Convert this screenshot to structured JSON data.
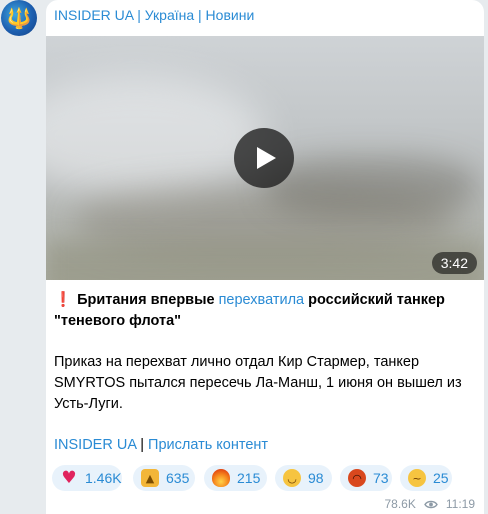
{
  "message": {
    "channel_name": "INSIDER UA | Україна | Новини",
    "video": {
      "duration": "3:42"
    },
    "text": {
      "exclamation": "❗",
      "headline_part1": "Британия впервые",
      "headline_link": "перехватила",
      "headline_part2": "российский танкер \"теневого флота\"",
      "body": "Приказ на перехват лично отдал Кир Стармер, танкер SMYRTOS пытался пересечь Ла-Манш, 1 июня он вышел из Усть-Луги."
    },
    "footer_links": {
      "channel": "INSIDER UA",
      "separator": "|",
      "submit": "Прислать контент"
    },
    "reactions": [
      {
        "emoji": "red-heart",
        "count": "1.46K"
      },
      {
        "emoji": "thumbs-up",
        "count": "635"
      },
      {
        "emoji": "fire",
        "count": "215"
      },
      {
        "emoji": "grinning-face",
        "count": "98"
      },
      {
        "emoji": "rage-face",
        "count": "73"
      },
      {
        "emoji": "thinking-face",
        "count": "25"
      }
    ],
    "views": "78.6K",
    "time": "11:19"
  },
  "colors": {
    "background": "#e7ebee",
    "bubble": "#ffffff",
    "link": "#2a8bd4",
    "reaction_bg": "#e8f2fb",
    "meta": "#8d9aa6"
  }
}
